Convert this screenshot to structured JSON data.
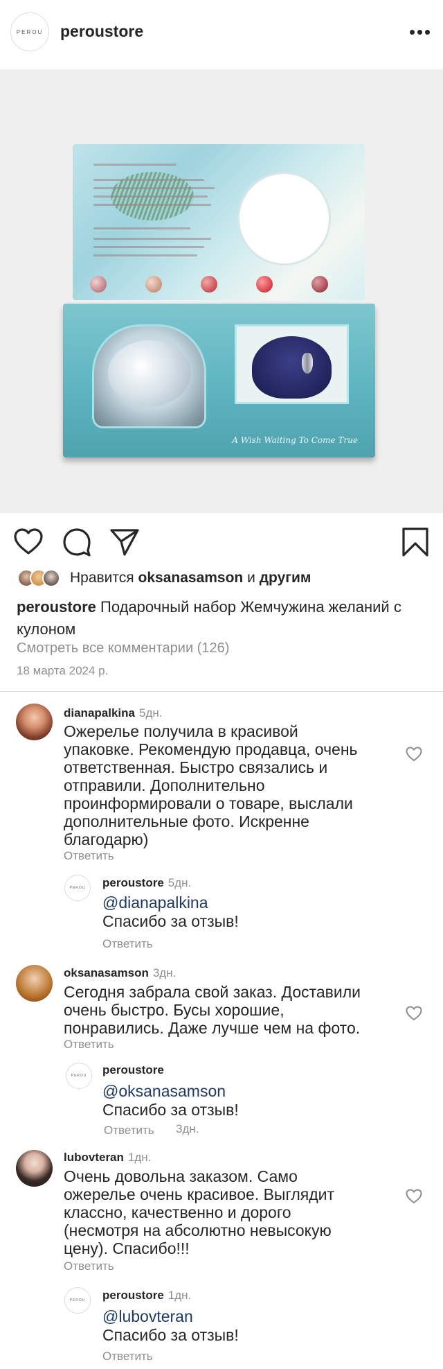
{
  "header": {
    "avatar_text": "PEROU",
    "username": "peroustore"
  },
  "post": {
    "photo_alt": "A Wish Waiting To Come True",
    "likes": {
      "prefix": "Нравится",
      "user": "oksanasamson",
      "joiner": "и",
      "others": "другим"
    },
    "caption": {
      "user": "peroustore",
      "text": "Подарочный набор Жемчужина желаний с кулоном"
    },
    "view_all": "Смотреть все комментарии (126)",
    "date": "18 марта 2024 р."
  },
  "comments": [
    {
      "user": "dianapalkina",
      "time": "5дн.",
      "lines": [
        "Ожерелье получила в красивой",
        "упаковке. Рекомендую продавца, очень",
        "ответственная. Быстро связались и",
        "отправили. Дополнительно",
        "проинформировали о товаре, выслали",
        "дополнительные фото. Искренне",
        "благодарю)"
      ],
      "reply_label": "Ответить",
      "reply": {
        "user": "peroustore",
        "time": "5дн.",
        "avatar_text": "PEROU",
        "mention": "@dianapalkina",
        "text": "Спасибо за отзыв!",
        "reply_label": "Ответить"
      }
    },
    {
      "user": "oksanasamson",
      "time": "3дн.",
      "lines": [
        "Сегодня забрала свой заказ. Доставили",
        "очень быстро. Бусы хорошие,",
        "понравились. Даже лучше чем на фото."
      ],
      "reply_label": "Ответить",
      "reply": {
        "user": "peroustore",
        "time": "3дн.",
        "avatar_text": "PEROU",
        "mention": "@oksanasamson",
        "text": "Спасибо за отзыв!",
        "reply_label": "Ответить"
      }
    },
    {
      "user": "lubovteran",
      "time": "1дн.",
      "lines": [
        "Очень довольна заказом. Само",
        "ожерелье очень красивое. Выглядит",
        "классно, качественно и дорого",
        "(несмотря на абсолютно невысокую",
        "цену). Спасибо!!!"
      ],
      "reply_label": "Ответить",
      "reply": {
        "user": "peroustore",
        "time": "1дн.",
        "avatar_text": "PEROU",
        "mention": "@lubovteran",
        "text": "Спасибо за отзыв!",
        "reply_label": "Ответить"
      }
    }
  ],
  "icons": {
    "like": "heart-icon",
    "comment": "comment-bubble-icon",
    "share": "paper-plane-icon",
    "save": "bookmark-icon",
    "more": "more-dots-icon"
  },
  "colors": {
    "text": "#262626",
    "muted": "#8e8e8e",
    "mention": "#1e3a60",
    "photo_bg": "#efefef"
  }
}
